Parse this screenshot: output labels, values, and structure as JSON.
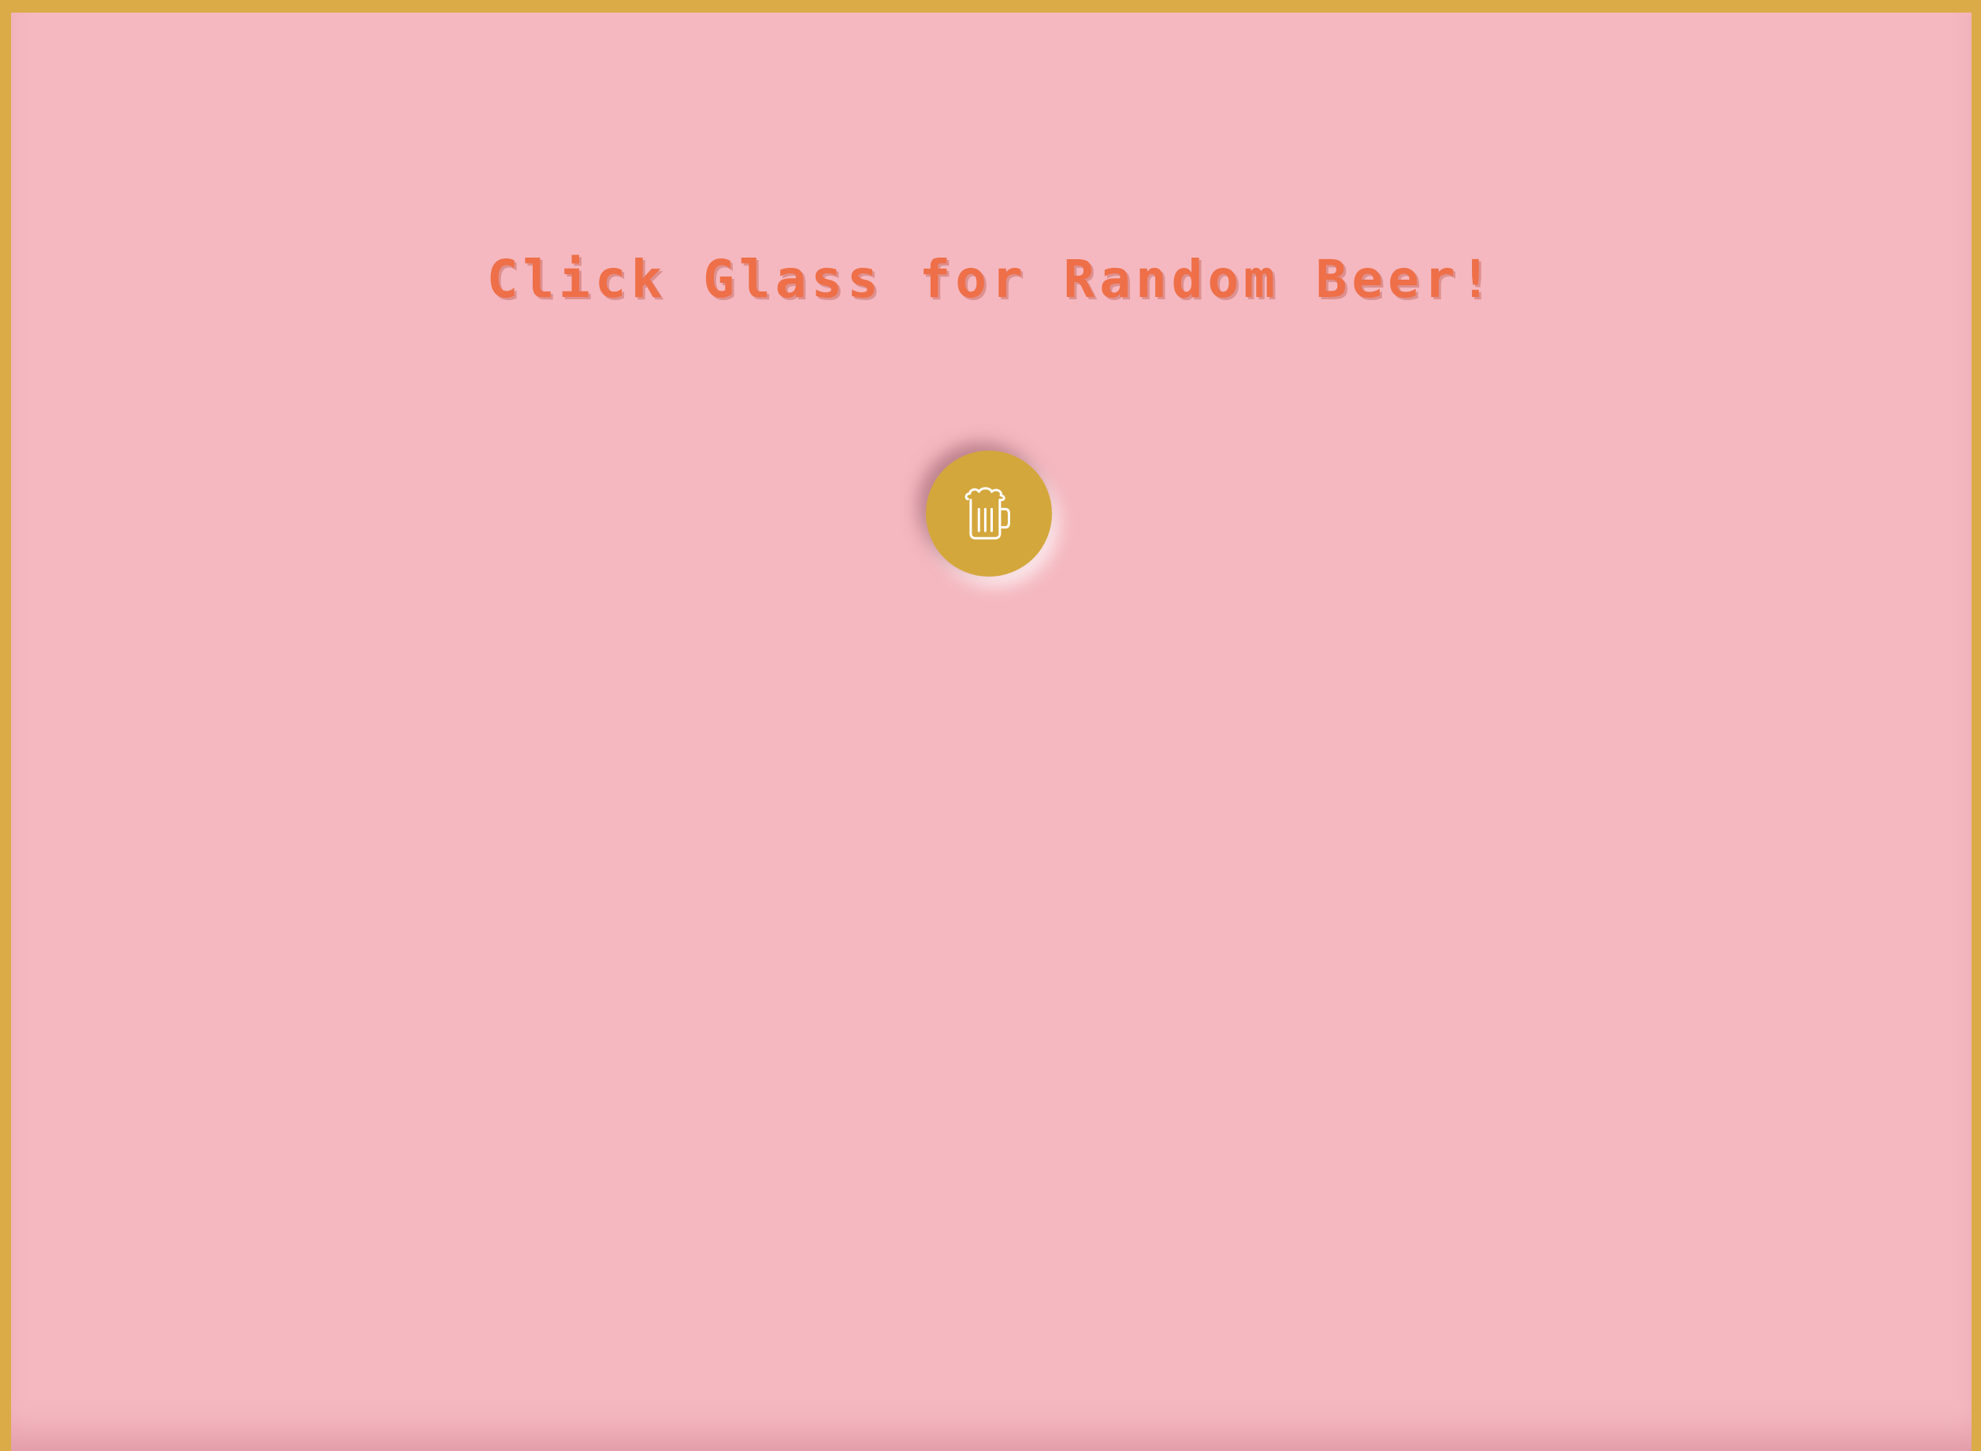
{
  "page": {
    "headline": "Click Glass for Random Beer!"
  },
  "button": {
    "icon": "beer-mug-icon",
    "aria_label": "Random beer"
  },
  "colors": {
    "frame": "#dbab48",
    "background": "#f5b8c0",
    "headline": "#ee6f48",
    "button": "#d4a73c",
    "icon": "#ffffff"
  }
}
